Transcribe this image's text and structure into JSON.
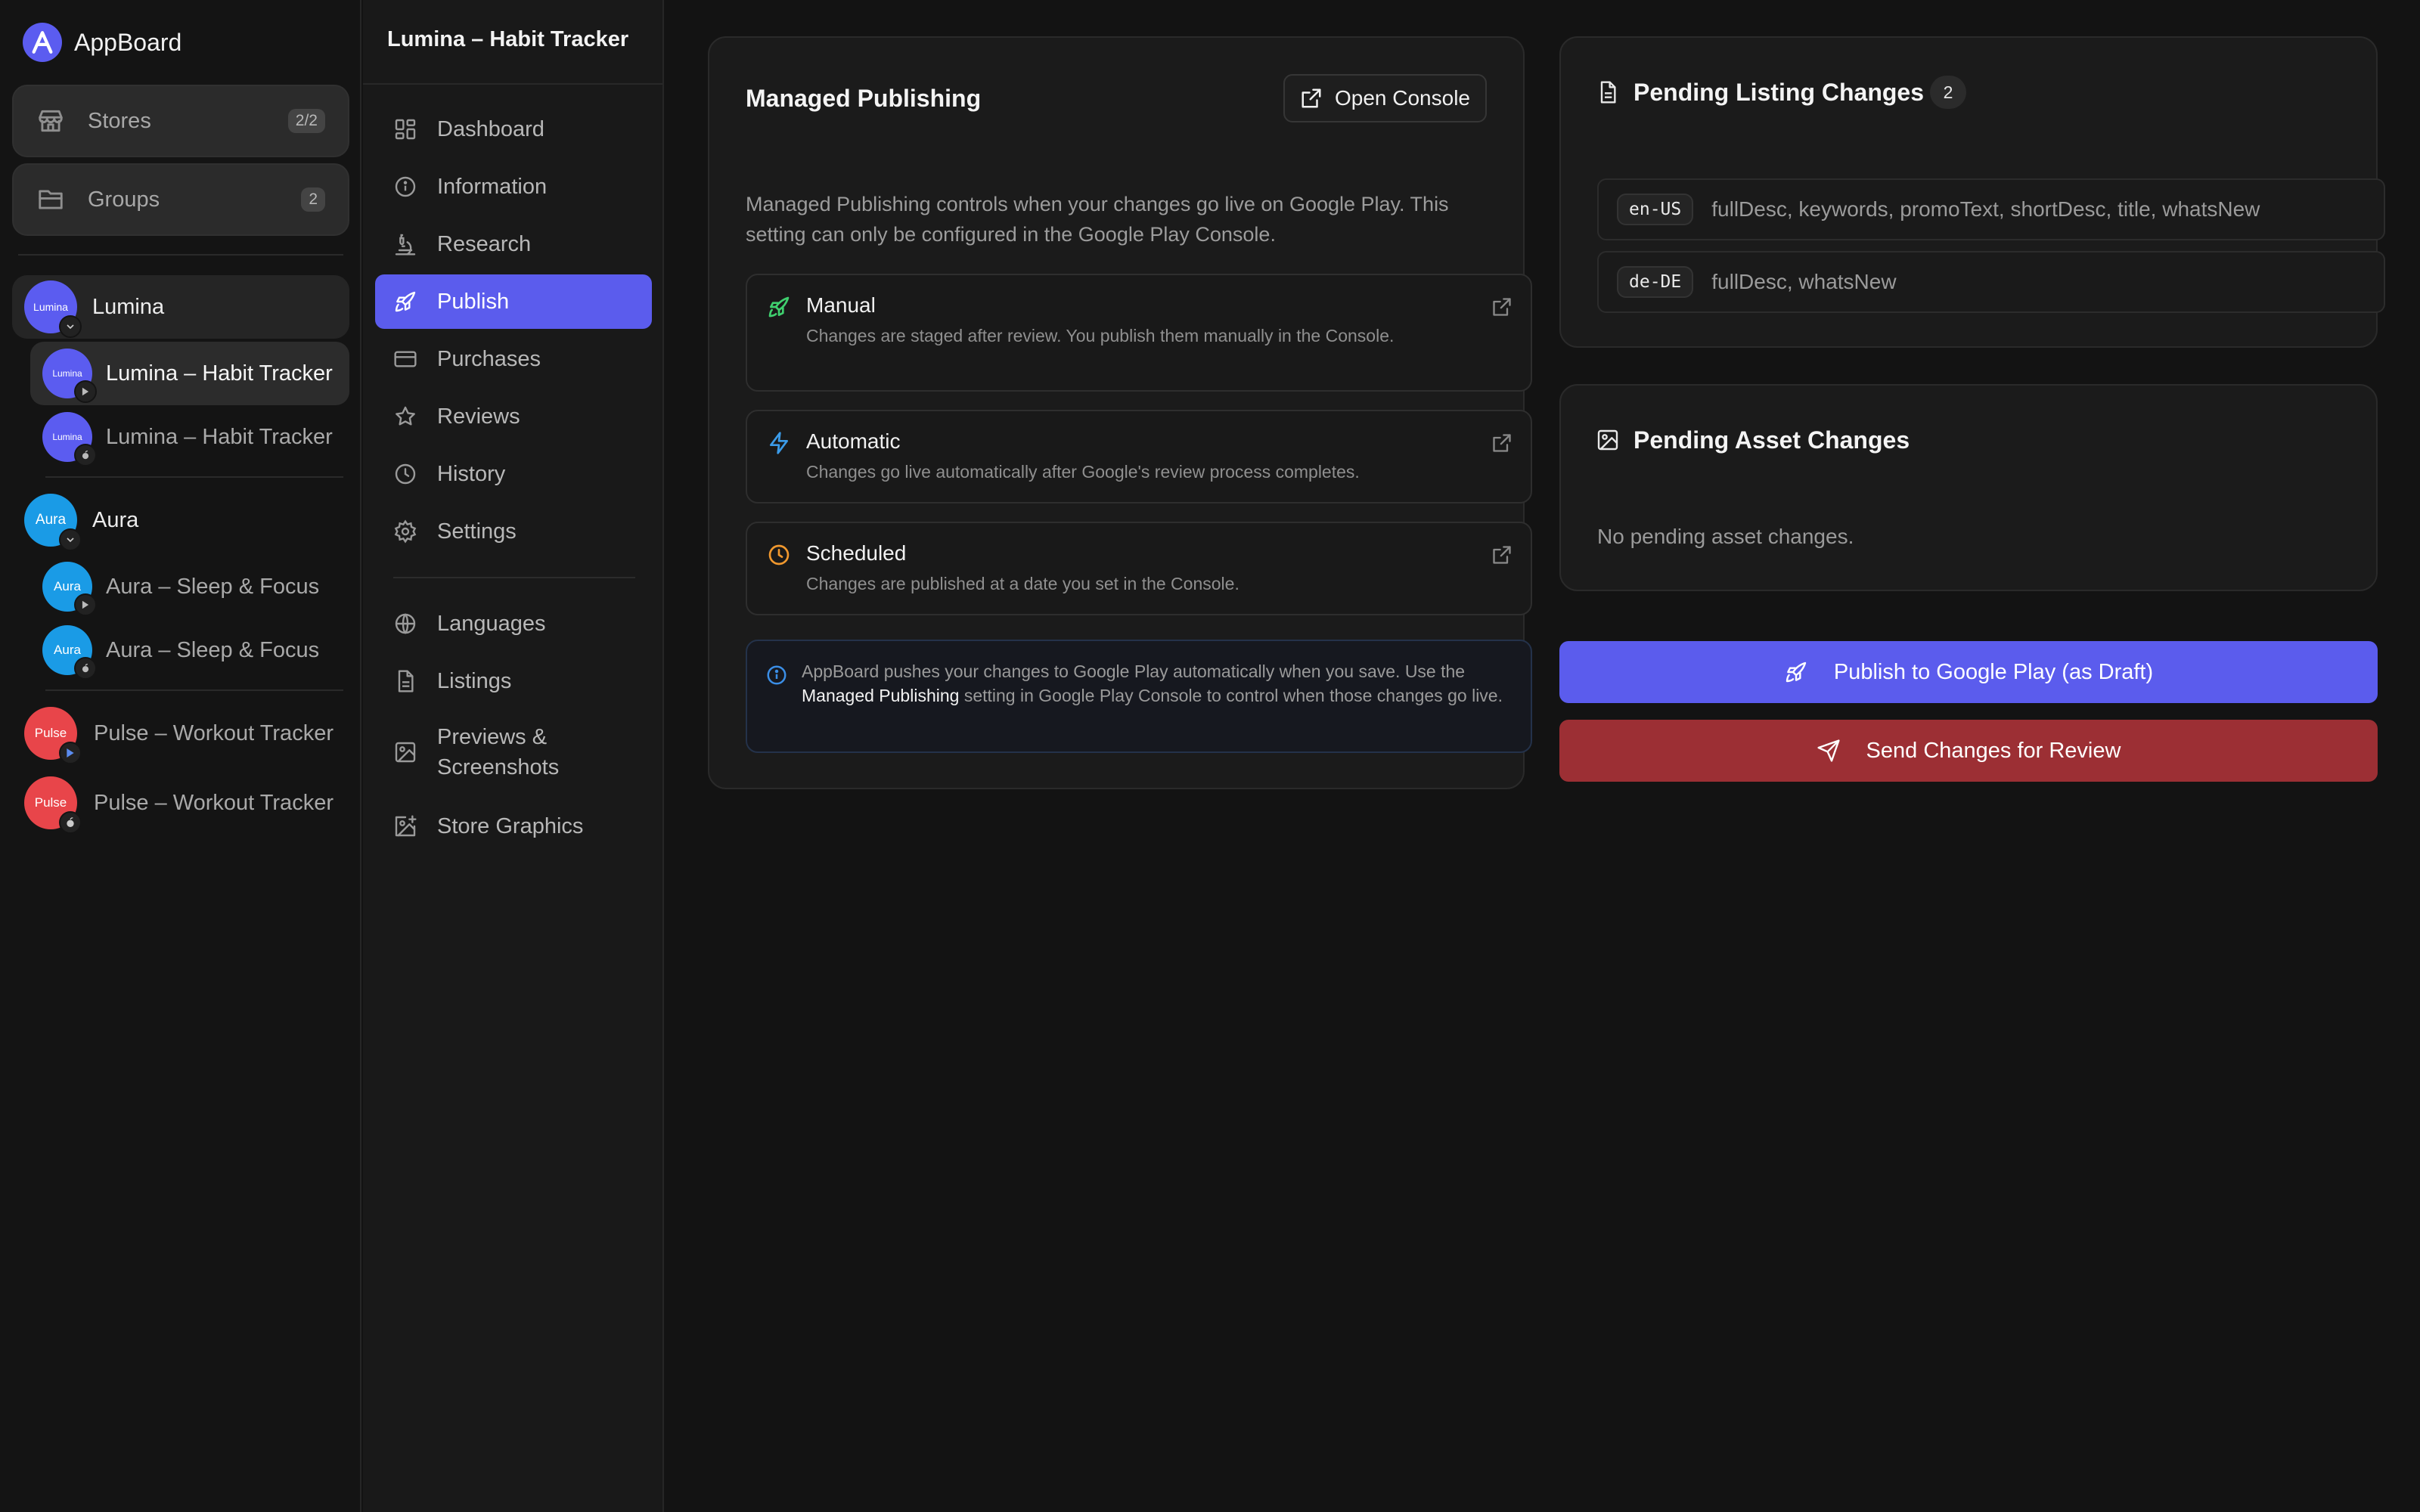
{
  "app": {
    "name": "AppBoard",
    "accent": "#5b5cf0",
    "danger": "#9c2f34"
  },
  "sidebar": {
    "stores": {
      "label": "Stores",
      "count": "2/2"
    },
    "groups": {
      "label": "Groups",
      "count": "2"
    },
    "apps": [
      {
        "group": "Lumina",
        "icon_text": "Lumina",
        "color": "#5b5cf0",
        "children": [
          {
            "label": "Lumina – Habit Tracker",
            "platform": "google-play",
            "icon_text": "Lumina"
          },
          {
            "label": "Lumina – Habit Tracker",
            "platform": "apple",
            "icon_text": "Lumina"
          }
        ]
      },
      {
        "group": "Aura",
        "icon_text": "Aura",
        "color": "#1a9be6",
        "children": [
          {
            "label": "Aura – Sleep & Focus",
            "platform": "google-play",
            "icon_text": "Aura"
          },
          {
            "label": "Aura – Sleep & Focus",
            "platform": "apple",
            "icon_text": "Aura"
          }
        ]
      },
      {
        "group": "Pulse",
        "icon_text": "Pulse",
        "color": "#e8454a",
        "children": [
          {
            "label": "Pulse – Workout Tracker",
            "platform": "google-play",
            "icon_text": "Pulse"
          },
          {
            "label": "Pulse – Workout Tracker",
            "platform": "apple",
            "icon_text": "Pulse"
          }
        ]
      }
    ]
  },
  "nav": {
    "project_title": "Lumina – Habit Tracker",
    "items": [
      {
        "label": "Dashboard",
        "icon": "dashboard-icon"
      },
      {
        "label": "Information",
        "icon": "info-icon"
      },
      {
        "label": "Research",
        "icon": "microscope-icon"
      },
      {
        "label": "Publish",
        "icon": "rocket-icon",
        "active": true
      },
      {
        "label": "Purchases",
        "icon": "credit-card-icon"
      },
      {
        "label": "Reviews",
        "icon": "star-icon"
      },
      {
        "label": "History",
        "icon": "clock-icon"
      },
      {
        "label": "Settings",
        "icon": "gear-icon"
      }
    ],
    "items2": [
      {
        "label": "Languages",
        "icon": "globe-icon"
      },
      {
        "label": "Listings",
        "icon": "document-icon"
      },
      {
        "label": "Previews & Screenshots",
        "icon": "image-icon"
      },
      {
        "label": "Store Graphics",
        "icon": "image-plus-icon"
      }
    ]
  },
  "managed": {
    "title": "Managed Publishing",
    "open_console": "Open Console",
    "description": "Managed Publishing controls when your changes go live on Google Play. This setting can only be configured in the Google Play Console.",
    "options": [
      {
        "title": "Manual",
        "desc": "Changes are staged after review. You publish them manually in the Console.",
        "color": "#3fcf6e"
      },
      {
        "title": "Automatic",
        "desc": "Changes go live automatically after Google's review process completes.",
        "color": "#3b9be8"
      },
      {
        "title": "Scheduled",
        "desc": "Changes are published at a date you set in the Console.",
        "color": "#f0982e"
      }
    ],
    "info": {
      "part1": "AppBoard pushes your changes to Google Play automatically when you save. Use the ",
      "strong": "Managed Publishing",
      "part2": " setting in Google Play Console to control when those changes go live."
    }
  },
  "listing_changes": {
    "title": "Pending Listing Changes",
    "count": "2",
    "rows": [
      {
        "locale": "en-US",
        "fields": "fullDesc, keywords, promoText, shortDesc, title, whatsNew"
      },
      {
        "locale": "de-DE",
        "fields": "fullDesc, whatsNew"
      }
    ]
  },
  "asset_changes": {
    "title": "Pending Asset Changes",
    "empty": "No pending asset changes."
  },
  "actions": {
    "publish": "Publish to Google Play (as Draft)",
    "review": "Send Changes for Review"
  }
}
